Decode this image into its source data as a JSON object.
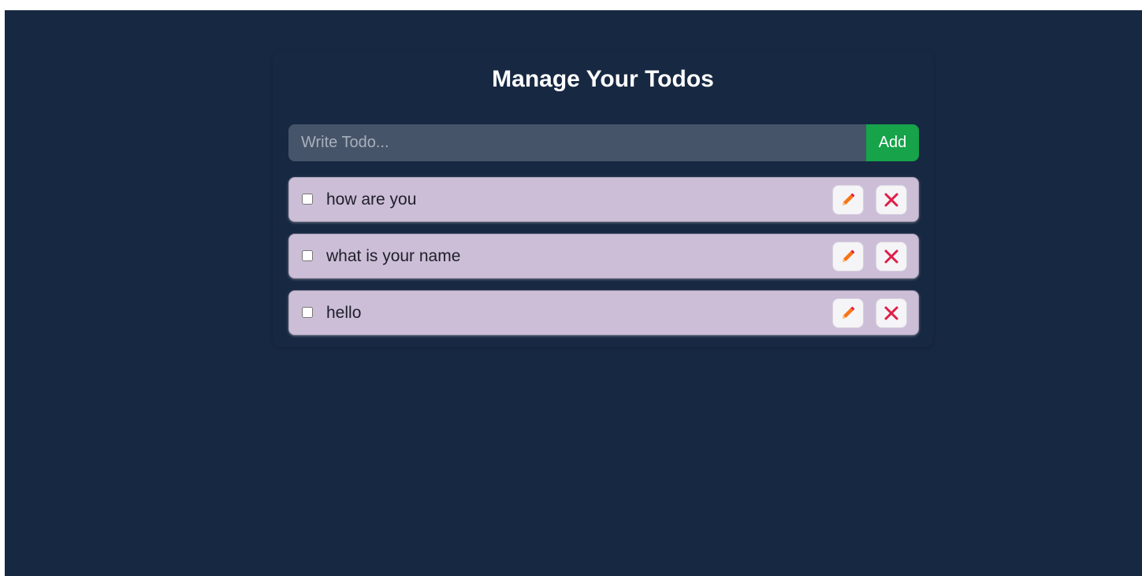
{
  "page": {
    "title": "Manage Your Todos"
  },
  "form": {
    "placeholder": "Write Todo...",
    "value": "",
    "add_label": "Add"
  },
  "todos": [
    {
      "text": "how are you",
      "completed": false,
      "edit_icon": "pencil-icon",
      "delete_icon": "close-icon"
    },
    {
      "text": "what is your name",
      "completed": false,
      "edit_icon": "pencil-icon",
      "delete_icon": "close-icon"
    },
    {
      "text": "hello",
      "completed": false,
      "edit_icon": "pencil-icon",
      "delete_icon": "close-icon"
    }
  ],
  "colors": {
    "background": "#172842",
    "input_background": "#465469",
    "add_button": "#16a34a",
    "todo_background": "#ccbed7",
    "edit_icon": "#f97316",
    "delete_icon": "#e11d48"
  }
}
